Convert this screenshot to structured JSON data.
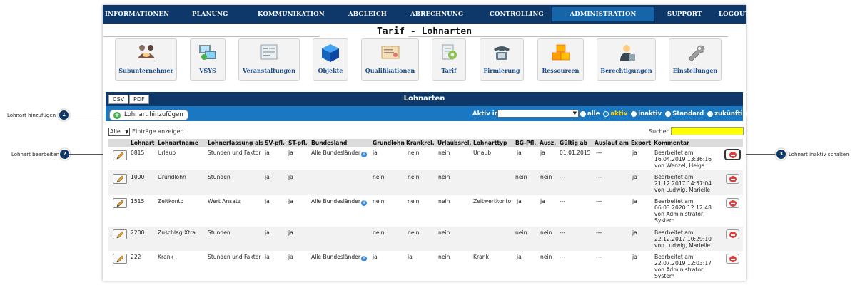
{
  "nav": {
    "items": [
      "INFORMATIONEN",
      "PLANUNG",
      "KOMMUNIKATION",
      "ABGLEICH",
      "ABRECHNUNG",
      "CONTROLLING",
      "ADMINISTRATION",
      "SUPPORT",
      "LOGOUT"
    ],
    "active": "ADMINISTRATION",
    "colors": {
      "nav_bg": "#0d3869",
      "active_bg": "#1565a8"
    }
  },
  "page_title": "Tarif - Lohnarten",
  "tiles": [
    {
      "label": "Subunternehmer",
      "icon": "handshake-icon"
    },
    {
      "label": "VSYS",
      "icon": "computer-network-icon"
    },
    {
      "label": "Veranstaltungen",
      "icon": "event-chart-icon"
    },
    {
      "label": "Objekte",
      "icon": "cube-icon"
    },
    {
      "label": "Qualifikationen",
      "icon": "certificate-icon"
    },
    {
      "label": "Tarif",
      "icon": "tariff-document-icon"
    },
    {
      "label": "Firmierung",
      "icon": "telephone-icon"
    },
    {
      "label": "Ressourcen",
      "icon": "boxes-icon"
    },
    {
      "label": "Berechtigungen",
      "icon": "user-permissions-icon"
    },
    {
      "label": "Einstellungen",
      "icon": "wrench-icon"
    }
  ],
  "panel": {
    "csv_label": "CSV",
    "pdf_label": "PDF",
    "title": "Lohnarten",
    "add_label": "Lohnart hinzufügen",
    "aktiv_label": "Aktiv in",
    "aktiv_value": "-",
    "radios": [
      {
        "label": "alle",
        "selected": false
      },
      {
        "label": "aktiv",
        "selected": true
      },
      {
        "label": "inaktiv",
        "selected": false
      },
      {
        "label": "Standard",
        "selected": false
      },
      {
        "label": "zukünftige",
        "selected": false
      }
    ],
    "length_value": "Alle",
    "length_label": "Einträge anzeigen",
    "search_label": "Suchen",
    "search_value": ""
  },
  "table": {
    "headers": [
      "Lohnart",
      "Lohnartname",
      "Lohnerfassung als",
      "SV-pfl.",
      "ST-pfl.",
      "Bundesland",
      "Grundlohn",
      "Krankrel.",
      "Urlaubsrel.",
      "Lohnarttyp",
      "BG-Pfl.",
      "Ausz.",
      "Gültig ab",
      "Auslauf am",
      "Export",
      "Kommentar"
    ],
    "rows": [
      {
        "lohnart": "0815",
        "name": "Urlaub",
        "erfassung": "Stunden und Faktor",
        "sv": "ja",
        "st": "ja",
        "bundesland": "Alle Bundesländer",
        "info": true,
        "grundlohn": "ja",
        "krank": "nein",
        "urlaub": "nein",
        "typ": "Urlaub",
        "bg": "ja",
        "ausz": "ja",
        "gueltig": "01.01.2015",
        "auslauf": "---",
        "export": "ja",
        "kommentar": [
          "Bearbeitet am",
          "16.04.2019 13:36:16",
          "von Wenzel, Helga"
        ]
      },
      {
        "lohnart": "1000",
        "name": "Grundlohn",
        "erfassung": "Stunden",
        "sv": "ja",
        "st": "ja",
        "bundesland": "",
        "info": false,
        "grundlohn": "nein",
        "krank": "nein",
        "urlaub": "nein",
        "typ": "",
        "bg": "nein",
        "ausz": "nein",
        "gueltig": "---",
        "auslauf": "---",
        "export": "ja",
        "kommentar": [
          "Bearbeitet am",
          "21.12.2017 14:57:04",
          "von Ludwig, Marielle"
        ]
      },
      {
        "lohnart": "1515",
        "name": "Zeitkonto",
        "erfassung": "Wert Ansatz",
        "sv": "ja",
        "st": "ja",
        "bundesland": "Alle Bundesländer",
        "info": true,
        "grundlohn": "nein",
        "krank": "nein",
        "urlaub": "nein",
        "typ": "Zeitwertkonto",
        "bg": "ja",
        "ausz": "ja",
        "gueltig": "---",
        "auslauf": "---",
        "export": "ja",
        "kommentar": [
          "Bearbeitet am",
          "06.03.2020 12:12:48",
          "von Administrator,",
          "System"
        ]
      },
      {
        "lohnart": "2200",
        "name": "Zuschlag Xtra",
        "erfassung": "Stunden",
        "sv": "ja",
        "st": "ja",
        "bundesland": "",
        "info": false,
        "grundlohn": "nein",
        "krank": "nein",
        "urlaub": "nein",
        "typ": "",
        "bg": "nein",
        "ausz": "nein",
        "gueltig": "---",
        "auslauf": "---",
        "export": "ja",
        "kommentar": [
          "Bearbeitet am",
          "22.12.2017 10:29:10",
          "von Ludwig, Marielle"
        ]
      },
      {
        "lohnart": "222",
        "name": "Krank",
        "erfassung": "Stunden und Faktor",
        "sv": "ja",
        "st": "ja",
        "bundesland": "Alle Bundesländer",
        "info": true,
        "grundlohn": "ja",
        "krank": "ja",
        "urlaub": "nein",
        "typ": "Krank",
        "bg": "ja",
        "ausz": "nein",
        "gueltig": "---",
        "auslauf": "---",
        "export": "ja",
        "kommentar": [
          "Bearbeitet am",
          "22.07.2019 12:03:17",
          "von Administrator,",
          "System"
        ]
      }
    ]
  },
  "callouts": [
    {
      "num": "1",
      "label": "Lohnart hinzufügen"
    },
    {
      "num": "2",
      "label": "Lohnart bearbeiten"
    },
    {
      "num": "3",
      "label": "Lohnart inaktiv schalten"
    }
  ]
}
